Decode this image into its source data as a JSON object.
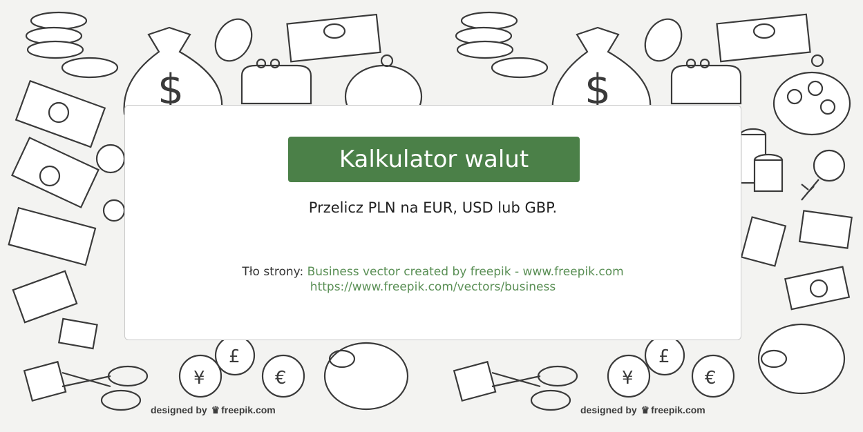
{
  "card": {
    "title": "Kalkulator walut",
    "subtitle": "Przelicz PLN na EUR, USD lub GBP.",
    "credit_prefix": "Tło strony:",
    "credit_link_1": "Business vector created by freepik - www.freepik.com",
    "credit_link_2": "https://www.freepik.com/vectors/business"
  },
  "watermark": {
    "left_prefix": "designed by",
    "left_brand": "freepik.com",
    "right_prefix": "designed by",
    "right_brand": "freepik.com"
  },
  "colors": {
    "accent": "#4b8048",
    "link": "#5a8f55",
    "background": "#f3f3f1"
  }
}
